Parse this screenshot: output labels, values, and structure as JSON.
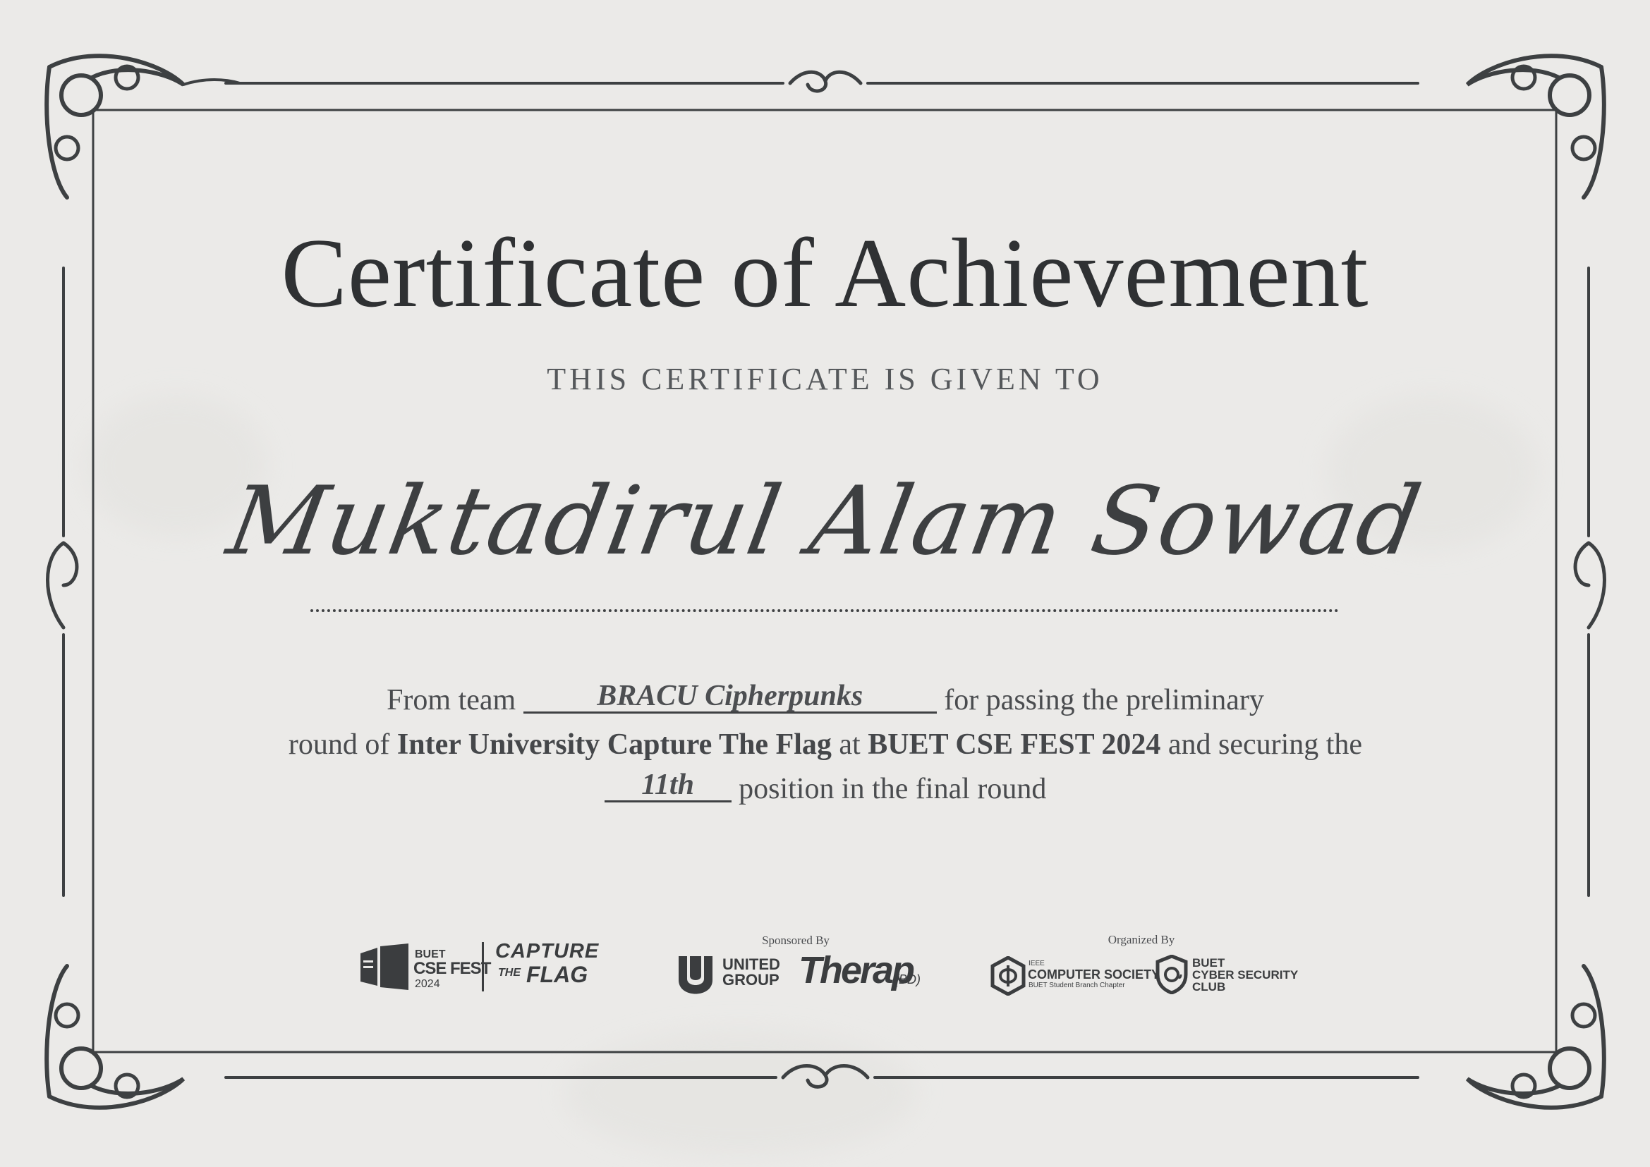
{
  "certificate": {
    "title": "Certificate of Achievement",
    "subtitle": "THIS CERTIFICATE IS GIVEN TO",
    "recipient": "Muktadirul Alam Sowad",
    "line_from_team": "From team",
    "team_name": "BRACU Cipherpunks",
    "line_passing": "for passing the preliminary",
    "line_round_of": "round of",
    "event_name": "Inter University Capture The Flag",
    "line_at": "at",
    "fest_name": "BUET CSE FEST 2024",
    "line_securing": "and securing the",
    "position": "11th",
    "line_final": "position in the final round"
  },
  "sponsors": {
    "sponsored_by_label": "Sponsored By",
    "organized_by_label": "Organized By",
    "buet_cse_fest": {
      "line1": "BUET",
      "line2": "CSE FEST",
      "line3": "2024"
    },
    "capture_the_flag": {
      "line1": "CAPTURE",
      "line2": "THE",
      "line3": "FLAG"
    },
    "united_group": {
      "line1": "UNITED",
      "line2": "GROUP"
    },
    "therap": {
      "name": "Therap",
      "suffix": "(BD)"
    },
    "ieee_cs": {
      "line1": "IEEE",
      "line2": "COMPUTER SOCIETY",
      "line3": "BUET Student Branch Chapter"
    },
    "buet_csc": {
      "line1": "BUET",
      "line2": "CYBER SECURITY",
      "line3": "CLUB"
    }
  },
  "colors": {
    "ink": "#3b3d3f",
    "paper": "#ebeae8"
  }
}
